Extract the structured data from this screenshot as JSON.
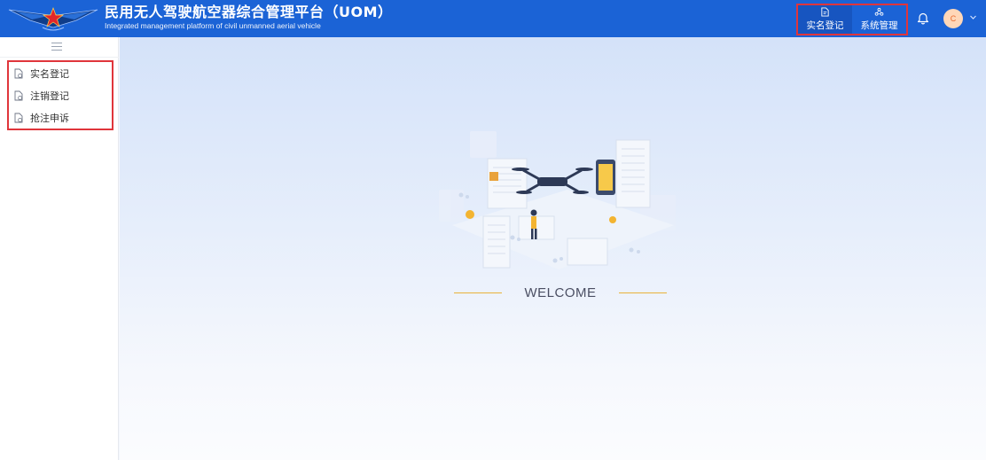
{
  "header": {
    "title": "民用无人驾驶航空器综合管理平台（UOM）",
    "subtitle": "Integrated management platform of civil unmanned aerial vehicle",
    "bg_color": "#1b63d6"
  },
  "topnav": {
    "items": [
      {
        "label": "实名登记",
        "icon": "document-icon",
        "active": true
      },
      {
        "label": "系统管理",
        "icon": "settings-nodes-icon",
        "active": false
      }
    ],
    "highlight_color": "#e0353b"
  },
  "user": {
    "avatar_initial": "C",
    "notification_icon": "bell-icon"
  },
  "sidebar": {
    "collapse_icon": "menu-icon",
    "items": [
      {
        "label": "实名登记",
        "icon": "document-icon"
      },
      {
        "label": "注销登记",
        "icon": "document-icon"
      },
      {
        "label": "抢注申诉",
        "icon": "document-icon"
      }
    ]
  },
  "main": {
    "welcome": "WELCOME",
    "accent_color": "#e9b23a"
  }
}
